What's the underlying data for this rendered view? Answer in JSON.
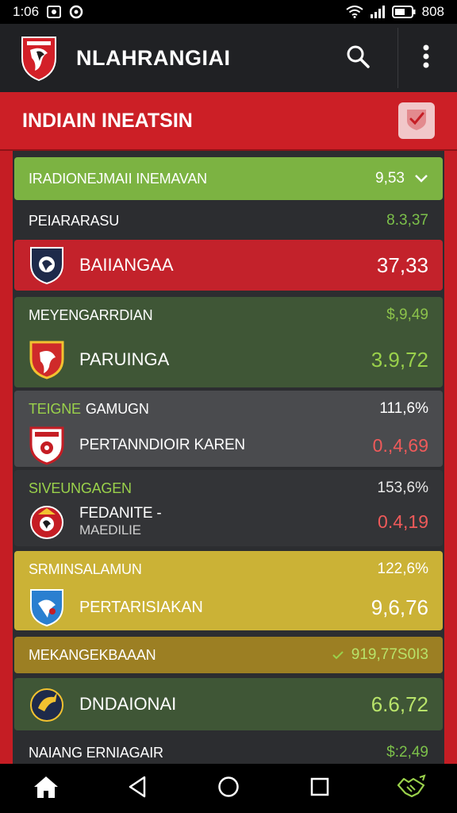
{
  "status_bar": {
    "time": "1:06",
    "battery_text": "808"
  },
  "app_bar": {
    "title": "NLAHRANGIAI"
  },
  "section": {
    "title": "INDIAIN INEATSIN"
  },
  "rows": {
    "r1": {
      "label": "IRADIONEJMAII INEMAVAN",
      "value": "9,53"
    },
    "r2": {
      "label": "PEIARARASU",
      "value": "8.3,37"
    },
    "r3": {
      "name": "BAIIANGAA",
      "value": "37,33"
    },
    "r4": {
      "label": "MEYENGARRDIAN",
      "value": "$,9,49",
      "name": "PARUINGA",
      "big_value": "3.9,72"
    },
    "r5": {
      "label_a": "TEIGNE",
      "label_b": "GAMUGN",
      "value": "111,6%",
      "name": "PERTANNDIOIR KAREN",
      "big_value": "0.,4,69"
    },
    "r6": {
      "label": "SIVEUNGAGEN",
      "value": "153,6%",
      "name_a": "FEDANITE -",
      "name_b": "MAEDILIE",
      "big_value": "0.4,19"
    },
    "r7": {
      "label": "SRMINSALAMUN",
      "value": "122,6%",
      "name": "PERTARISIAKAN",
      "big_value": "9,6,76"
    },
    "r8": {
      "label": "MEKANGEKBAAAN",
      "value": "919,77S0I3"
    },
    "r9": {
      "name": "DNDAIONAI",
      "big_value": "6.6,72"
    },
    "r10": {
      "label": "NAIANG ERNIAGAIR",
      "value": "$:2,49"
    }
  },
  "colors": {
    "brand_red": "#cc1f26",
    "green_row": "#7cb342",
    "dark_green": "#3f5636",
    "gold": "#cbb236",
    "olive": "#9c7f23",
    "positive": "#9ad14b",
    "negative": "#ef5a5a"
  },
  "icons": [
    "wifi-icon",
    "signal-icon",
    "battery-icon",
    "search-icon",
    "more-vert-icon",
    "check-badge-icon",
    "home-icon",
    "back-icon",
    "circle-home-icon",
    "recent-apps-icon",
    "handshake-icon"
  ]
}
